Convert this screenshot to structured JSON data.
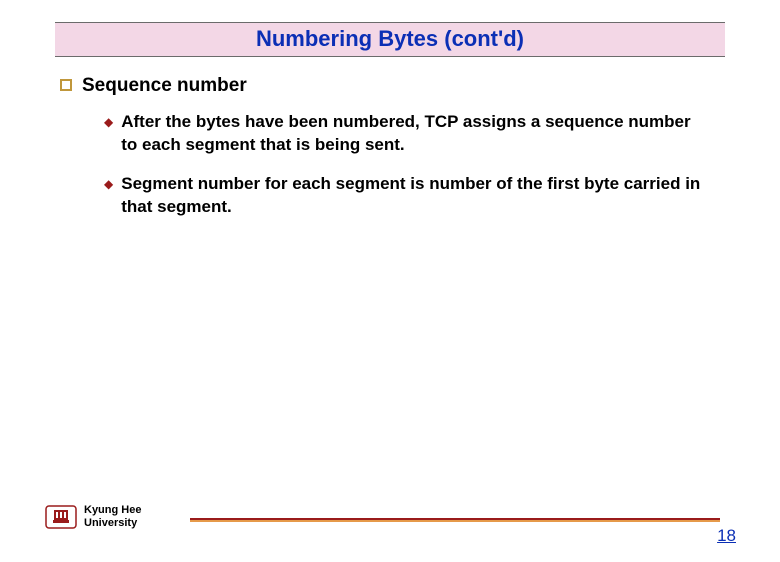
{
  "title": "Numbering Bytes (cont'd)",
  "heading": "Sequence number",
  "bullets": [
    "After the bytes have been numbered, TCP assigns a sequence number to each segment that is being sent.",
    "Segment number for each segment is number of the first byte carried in that segment."
  ],
  "footer": {
    "org_line1": "Kyung Hee",
    "org_line2": "University",
    "page": "18"
  }
}
